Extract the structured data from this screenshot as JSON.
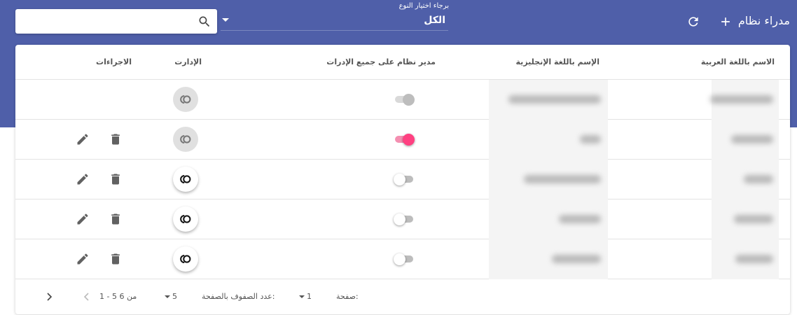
{
  "header": {
    "title": "مدراء نظام",
    "add_icon": "plus-icon",
    "refresh_icon": "refresh-icon",
    "type_filter": {
      "label": "برجاء اختيار النوع",
      "value": "الكل"
    },
    "search": {
      "value": "",
      "placeholder": "",
      "icon": "search-icon"
    }
  },
  "table": {
    "columns": {
      "arabic_name": "الاسم باللغة العربية",
      "english_name": "الإسم باللغة الإنجليزية",
      "all_depts_admin": "مدير نظام على جميع الإدرات",
      "departments": "الإدارت",
      "actions": "الاجراءات"
    },
    "rows": [
      {
        "all_depts_admin": "disabled-on",
        "departments_enabled": false,
        "has_actions": false
      },
      {
        "all_depts_admin": "on",
        "departments_enabled": false,
        "has_actions": true
      },
      {
        "all_depts_admin": "off",
        "departments_enabled": true,
        "has_actions": true
      },
      {
        "all_depts_admin": "off",
        "departments_enabled": true,
        "has_actions": true
      },
      {
        "all_depts_admin": "off",
        "departments_enabled": true,
        "has_actions": true
      }
    ],
    "row_icons": {
      "departments": "toggle-circle-icon",
      "delete": "delete-icon",
      "edit": "edit-icon"
    }
  },
  "pagination": {
    "page_label": "صفحة:",
    "page_value": "1",
    "rows_per_page_label": "عدد الصفوف بالصفحة:",
    "rows_per_page_value": "5",
    "range": "1 - 5 من 6"
  },
  "colors": {
    "banner": "#4f5fa9",
    "toggle_on": "#ff4081",
    "icon": "#616161"
  }
}
